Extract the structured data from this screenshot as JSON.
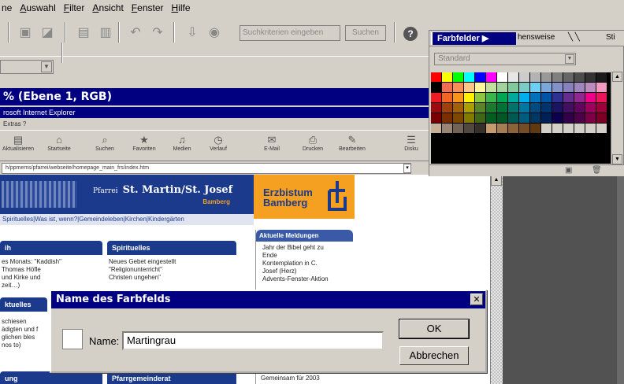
{
  "menubar": {
    "items": [
      "ne",
      "Auswahl",
      "Filter",
      "Ansicht",
      "Fenster",
      "Hilfe"
    ]
  },
  "toolbar": {
    "search_placeholder": "Suchkriterien eingeben",
    "search_button": "Suchen",
    "help_icon": "question-circle-icon"
  },
  "document": {
    "title": "% (Ebene 1, RGB)"
  },
  "browser": {
    "title": "rosoft Internet Explorer",
    "menu": "Extras  ?",
    "buttons": [
      "Aktualisieren",
      "Startseite",
      "Suchen",
      "Favoriten",
      "Medien",
      "Verlauf",
      "E-Mail",
      "Drucken",
      "Bearbeiten",
      "Disku"
    ],
    "address": "h/ppmems/pfarrei/webseite/homepage_main_frs/index.htm"
  },
  "webpage": {
    "parish_prefix": "Pfarrei",
    "parish_name": "St. Martin/St. Josef",
    "city": "Bamberg",
    "diocese_line1": "Erzbistum",
    "diocese_line2": "Bamberg",
    "nav": "Spirituelles|Was ist, wenn?|Gemeindeleben|Kirchen|Kindergärten",
    "sec_left_1": "ih",
    "sec_spirituelles": "Spirituelles",
    "txt_left_1": "es Monats: \"Kaddish\"\nThomas Höfle\nund Kirke und\nzeit…)",
    "txt_spir": "Neues Gebet eingestellt\n\"Religionunterricht\"\nChristen ungehen\"",
    "sec_aktuelles": "ktuelles",
    "txt_left_2": "schiesen\nädigten und f\nglichen bles\nnos to)",
    "sec_left_3": "ung",
    "sec_pfarrgemeinderat": "Pfarrgemeinderat",
    "news_head": "Aktuelle Meldungen",
    "news_items": "Jahr der Bibel geht zu\nEnde\nKontemplation in C.\nJosef (Herz)\nAdvents-Fenster-Aktion",
    "news_bottom": "Gemeinsam für 2003"
  },
  "swatches_panel": {
    "tab_active": "Farbfelder",
    "tab_2": "hensweise",
    "tab_3": "Sti",
    "preset": "Standard",
    "rows": [
      [
        "#ff0000",
        "#ffff00",
        "#00ff00",
        "#00ffff",
        "#0000ff",
        "#ff00ff",
        "#ffffff",
        "#e6e6e6",
        "#cccccc",
        "#b3b3b3",
        "#999999",
        "#808080",
        "#666666",
        "#4d4d4d",
        "#333333",
        "#1a1a1a"
      ],
      [
        "#000000",
        "#f26c4f",
        "#f68e55",
        "#fdc689",
        "#fff799",
        "#c4df9b",
        "#a3d39c",
        "#82ca9c",
        "#7accc8",
        "#6dcff6",
        "#7da7d9",
        "#8393ca",
        "#8781bd",
        "#a186be",
        "#bd8cbf",
        "#f49ac1"
      ],
      [
        "#ed1c24",
        "#f26522",
        "#f7941d",
        "#fff200",
        "#8dc63f",
        "#39b54a",
        "#00a651",
        "#00a99d",
        "#00aeef",
        "#0072bc",
        "#0054a6",
        "#2e3192",
        "#662d91",
        "#92278f",
        "#ec008c",
        "#ed145b"
      ],
      [
        "#9e0b0f",
        "#a0410d",
        "#a36209",
        "#aba000",
        "#598527",
        "#1a7b30",
        "#007236",
        "#00746b",
        "#0076a3",
        "#004a80",
        "#003471",
        "#1b1464",
        "#440e62",
        "#630460",
        "#9e005d",
        "#9e0039"
      ],
      [
        "#790000",
        "#7b2e00",
        "#7d4900",
        "#827b00",
        "#406618",
        "#005e20",
        "#005826",
        "#005952",
        "#005b7f",
        "#003663",
        "#002157",
        "#0d004c",
        "#32004b",
        "#4b0049",
        "#7b0046",
        "#7a0026"
      ],
      [
        "#c7b299",
        "#998675",
        "#736357",
        "#534741",
        "#37302a",
        "#c69c6d",
        "#a67c52",
        "#8c6239",
        "#754c24",
        "#603913",
        "#d4d0c8",
        "#d4d0c8",
        "#d4d0c8",
        "#d4d0c8",
        "#d4d0c8",
        "#d4d0c8"
      ]
    ]
  },
  "dialog": {
    "title": "Name des Farbfelds",
    "name_label": "Name:",
    "name_value": "Martingrau",
    "ok_label": "OK",
    "cancel_label": "Abbrechen",
    "close_label": "✕"
  }
}
